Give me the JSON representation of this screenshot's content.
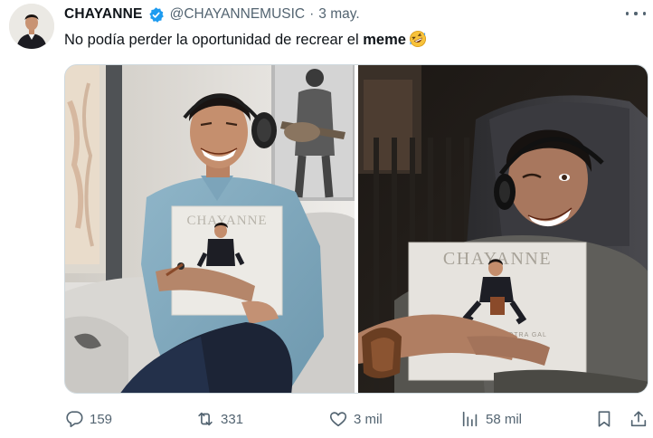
{
  "tweet": {
    "author_name": "CHAYANNE",
    "author_handle": "@CHAYANNEMUSIC",
    "separator": "·",
    "date": "3 may.",
    "text_prefix": "No podía perder la oportunidad de recrear el ",
    "text_bold": "meme",
    "emoji": "rolling-on-floor-laughing-emoji"
  },
  "media": {
    "left_album_title": "CHAYANNE",
    "right_album_title": "CHAYANNE",
    "right_album_subtitle": "DE OTRA GAL"
  },
  "actions": {
    "replies": "159",
    "reposts": "331",
    "likes": "3 mil",
    "views": "58 mil"
  },
  "colors": {
    "verified": "#1d9bf0",
    "secondary_text": "#536471",
    "primary_text": "#0f1419"
  }
}
